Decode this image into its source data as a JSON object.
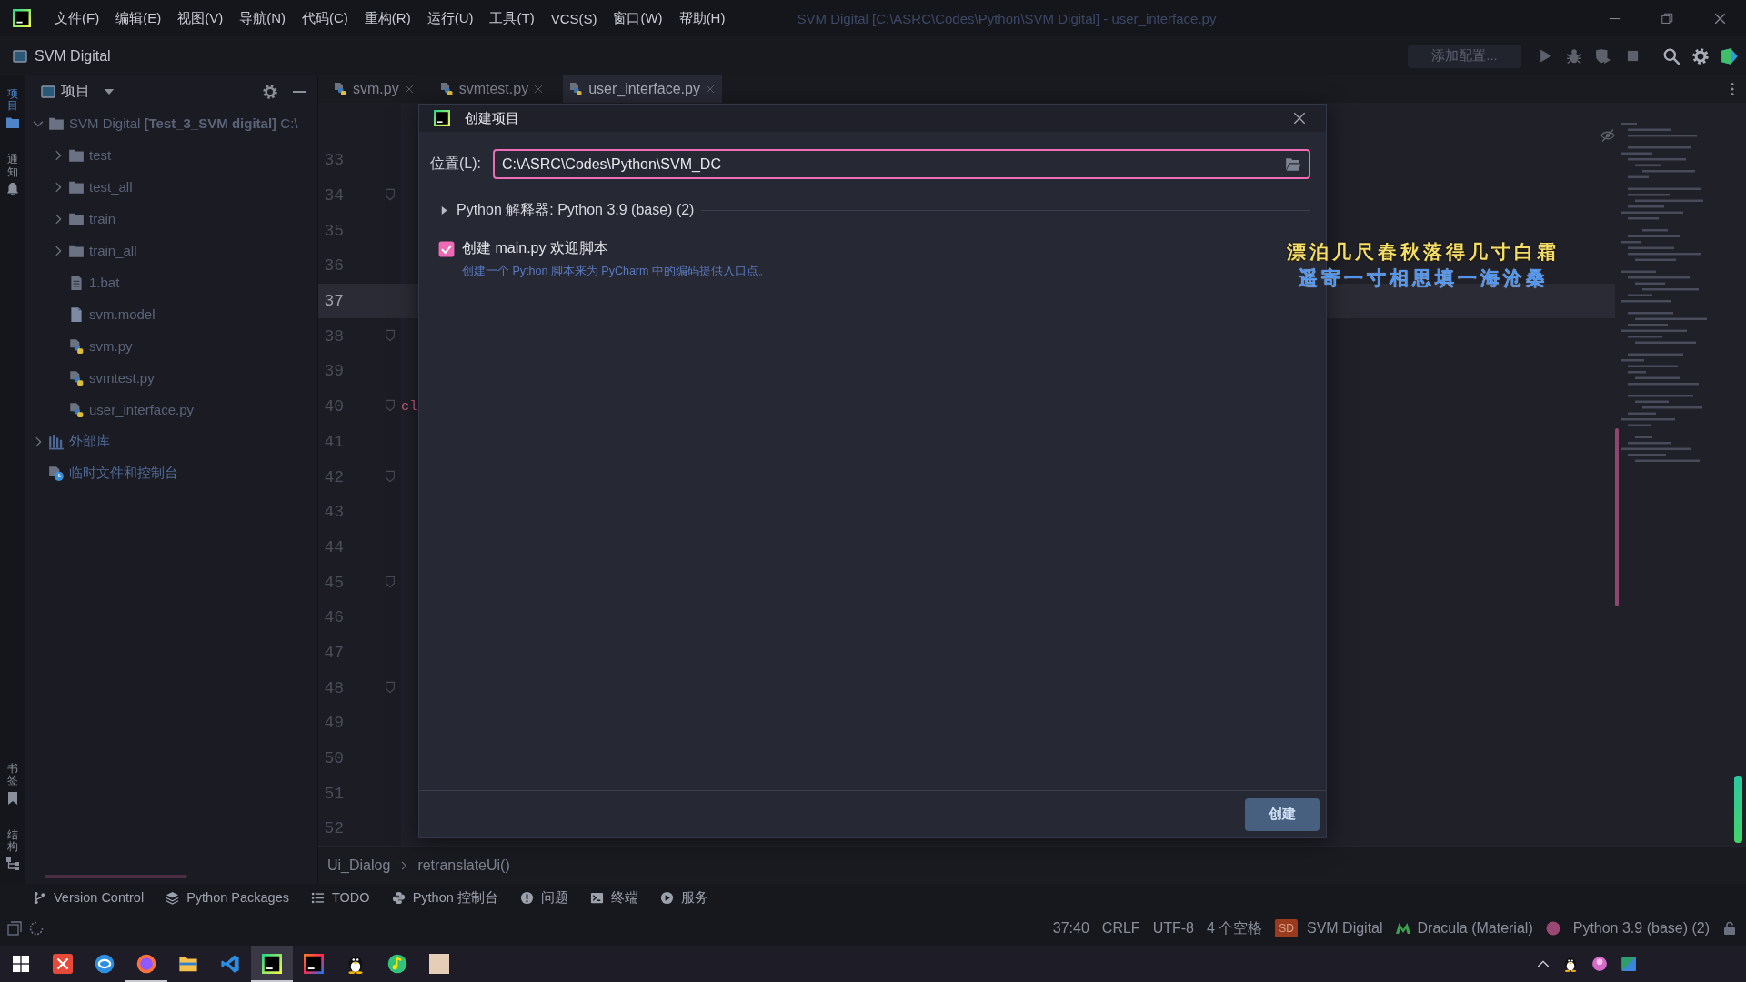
{
  "window": {
    "title": "SVM Digital [C:\\ASRC\\Codes\\Python\\SVM Digital] - user_interface.py"
  },
  "menu": [
    "文件(F)",
    "编辑(E)",
    "视图(V)",
    "导航(N)",
    "代码(C)",
    "重构(R)",
    "运行(U)",
    "工具(T)",
    "VCS(S)",
    "窗口(W)",
    "帮助(H)"
  ],
  "navigation_bar": {
    "project": "SVM Digital",
    "run_configuration": "添加配置..."
  },
  "left_tool_strip": {
    "top": [
      {
        "label": "项目",
        "selected": true
      },
      {
        "label": "通知",
        "selected": false
      }
    ],
    "bottom": [
      {
        "label": "书签",
        "selected": false
      },
      {
        "label": "结构",
        "selected": false
      }
    ]
  },
  "project_panel": {
    "title": "项目",
    "tree": [
      {
        "label": "SVM Digital **[Test_3_SVM digital]** C:\\",
        "kind": "folder",
        "expanded": true,
        "children": [
          {
            "label": "test",
            "kind": "folder",
            "expanded": false
          },
          {
            "label": "test_all",
            "kind": "folder",
            "expanded": false
          },
          {
            "label": "train",
            "kind": "folder",
            "expanded": false
          },
          {
            "label": "train_all",
            "kind": "folder",
            "expanded": false
          },
          {
            "label": "1.bat",
            "kind": "text-file"
          },
          {
            "label": "svm.model",
            "kind": "file"
          },
          {
            "label": "svm.py",
            "kind": "python-file"
          },
          {
            "label": "svmtest.py",
            "kind": "python-file"
          },
          {
            "label": "user_interface.py",
            "kind": "python-file"
          }
        ]
      },
      {
        "label": "外部库",
        "kind": "library",
        "expanded": false
      },
      {
        "label": "临时文件和控制台",
        "kind": "scratches"
      }
    ]
  },
  "editor": {
    "tabs": [
      {
        "label": "svm.py",
        "selected": false
      },
      {
        "label": "svmtest.py",
        "selected": false
      },
      {
        "label": "user_interface.py",
        "selected": true
      }
    ],
    "lines": [
      {
        "number": "33",
        "current": false,
        "fold_marker": false
      },
      {
        "number": "34",
        "current": false,
        "fold_marker": true
      },
      {
        "number": "35",
        "current": false,
        "fold_marker": false
      },
      {
        "number": "36",
        "current": false,
        "fold_marker": false
      },
      {
        "number": "37",
        "current": true,
        "fold_marker": false
      },
      {
        "number": "38",
        "current": false,
        "fold_marker": true
      },
      {
        "number": "39",
        "current": false,
        "fold_marker": false
      },
      {
        "number": "40",
        "current": false,
        "fold_marker": true,
        "code": "cl"
      },
      {
        "number": "41",
        "current": false,
        "fold_marker": false
      },
      {
        "number": "42",
        "current": false,
        "fold_marker": true
      },
      {
        "number": "43",
        "current": false,
        "fold_marker": false
      },
      {
        "number": "44",
        "current": false,
        "fold_marker": false
      },
      {
        "number": "45",
        "current": false,
        "fold_marker": true
      },
      {
        "number": "46",
        "current": false,
        "fold_marker": false
      },
      {
        "number": "47",
        "current": false,
        "fold_marker": false
      },
      {
        "number": "48",
        "current": false,
        "fold_marker": true
      },
      {
        "number": "49",
        "current": false,
        "fold_marker": false
      },
      {
        "number": "50",
        "current": false,
        "fold_marker": false
      },
      {
        "number": "51",
        "current": false,
        "fold_marker": false
      },
      {
        "number": "52",
        "current": false,
        "fold_marker": false
      }
    ]
  },
  "breadcrumbs": [
    "Ui_Dialog",
    "retranslateUi()"
  ],
  "dialog": {
    "title": "创建项目",
    "location": {
      "label": "位置(L):",
      "value": "C:\\ASRC\\Codes\\Python\\SVM_DC",
      "focused": true
    },
    "interpreter": {
      "label": "Python 解释器: Python 3.9 (base) (2)",
      "expanded": false
    },
    "create_main": {
      "label": "创建 main.py 欢迎脚本",
      "checked": true,
      "hint": "创建一个 Python 脚本来为 PyCharm 中的编码提供入口点。"
    },
    "create_button": "创建"
  },
  "desktop_lyrics": [
    "漂泊几尺春秋落得几寸白霜",
    "遥寄一寸相思填一海沧桑"
  ],
  "tool_windows": [
    "Version Control",
    "Python Packages",
    "TODO",
    "Python 控制台",
    "问题",
    "终端",
    "服务"
  ],
  "status_bar": {
    "caret_position": "37:40",
    "line_separator": "CRLF",
    "encoding": "UTF-8",
    "indent": "4 个空格",
    "project_badge": "SD",
    "project": "SVM Digital",
    "theme": "Dracula (Material)",
    "interpreter": "Python 3.9 (base) (2)"
  },
  "taskbar": {
    "apps": [
      {
        "running": false,
        "selected": false
      },
      {
        "running": false,
        "selected": false
      },
      {
        "running": true,
        "selected": false
      },
      {
        "running": false,
        "selected": false
      },
      {
        "running": false,
        "selected": false
      },
      {
        "running": true,
        "selected": true
      },
      {
        "running": false,
        "selected": false
      },
      {
        "running": false,
        "selected": false
      },
      {
        "running": false,
        "selected": false
      },
      {
        "running": false,
        "selected": false
      }
    ]
  }
}
